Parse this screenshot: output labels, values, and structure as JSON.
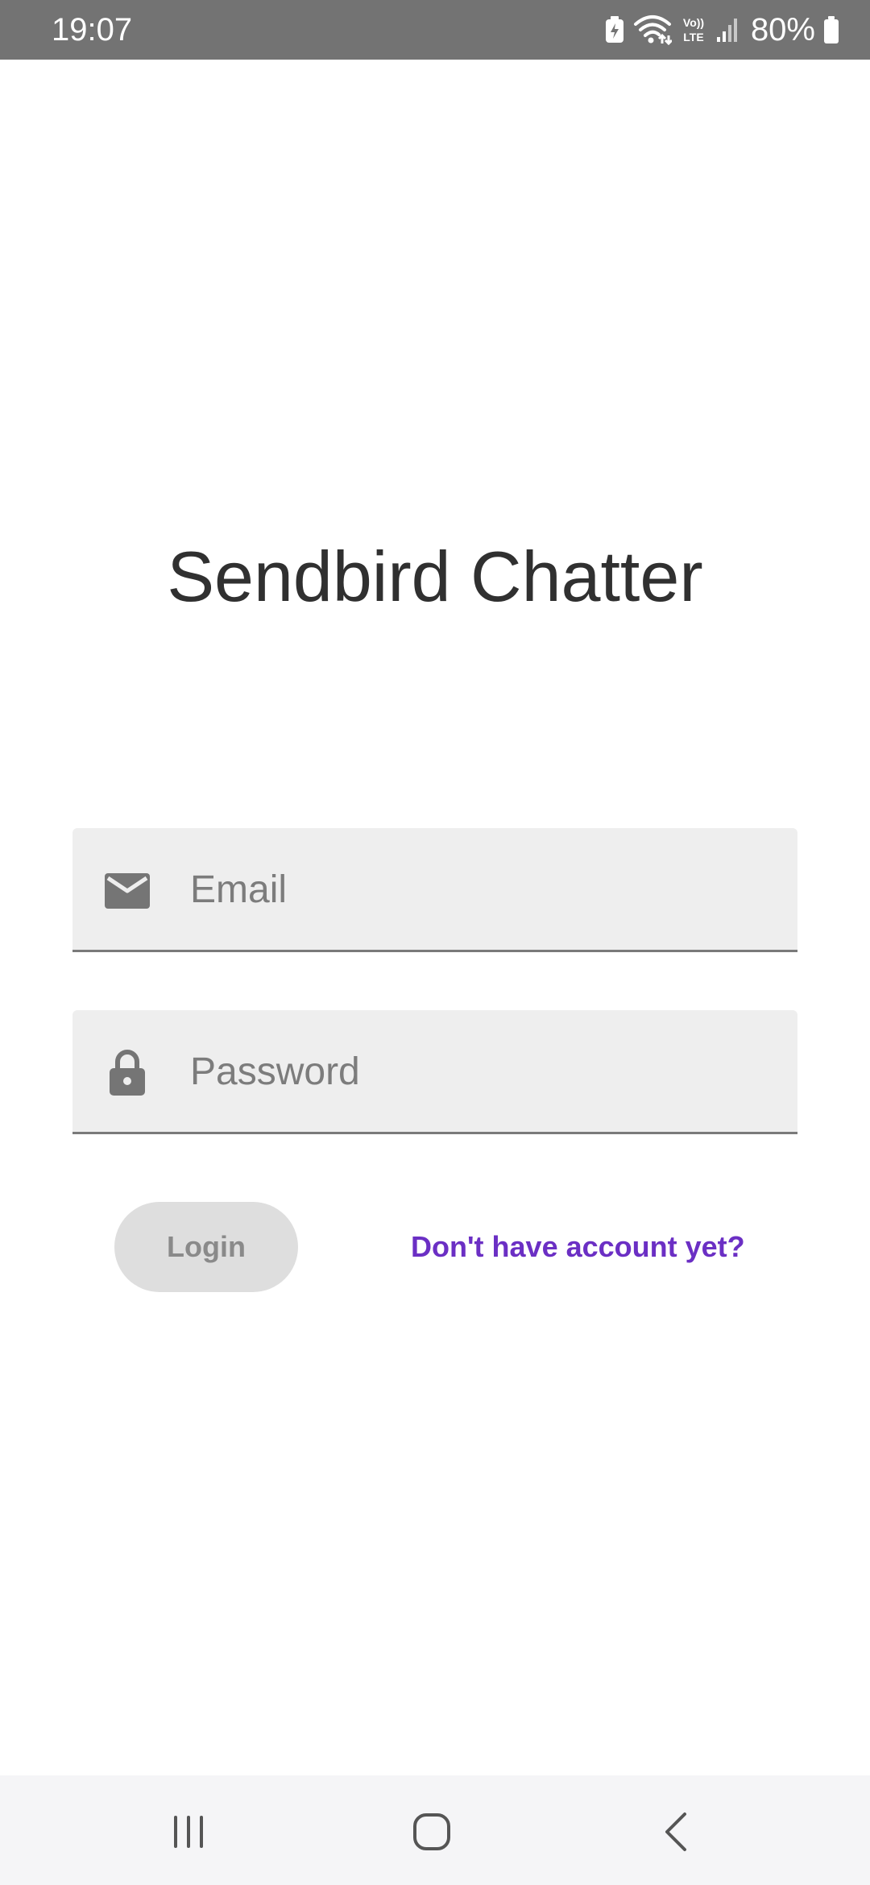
{
  "status_bar": {
    "time": "19:07",
    "battery": "80%",
    "icons": [
      "battery-saver-icon",
      "wifi-icon",
      "volte-icon",
      "signal-icon",
      "battery-icon"
    ],
    "volte_label_top": "Vo))",
    "volte_label_bottom": "LTE"
  },
  "app": {
    "title": "Sendbird Chatter"
  },
  "form": {
    "email": {
      "placeholder": "Email",
      "value": "",
      "icon": "mail-icon"
    },
    "password": {
      "placeholder": "Password",
      "value": "",
      "icon": "lock-icon"
    },
    "login_label": "Login",
    "signup_label": "Don't have account yet?"
  },
  "colors": {
    "status_bar": "#737373",
    "accent": "#6b2fc4",
    "field_bg": "#eeeeee",
    "button_disabled_bg": "#dedede",
    "title_text": "#303030"
  },
  "nav_bar": {
    "items": [
      "recents-icon",
      "home-icon",
      "back-icon"
    ]
  }
}
